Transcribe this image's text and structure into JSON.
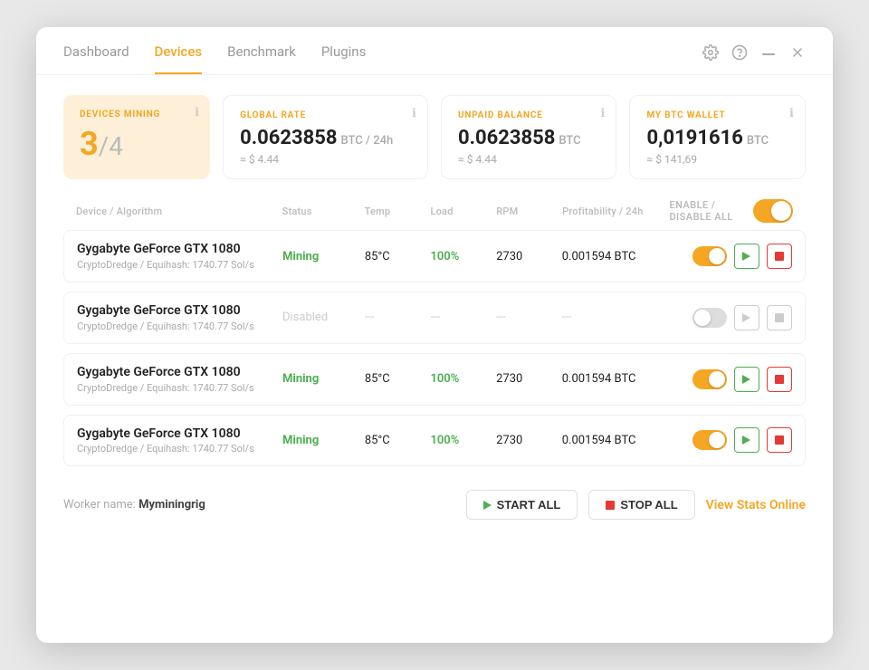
{
  "nav": {
    "tabs": [
      {
        "id": "dashboard",
        "label": "Dashboard",
        "active": false
      },
      {
        "id": "devices",
        "label": "Devices",
        "active": true
      },
      {
        "id": "benchmark",
        "label": "Benchmark",
        "active": false
      },
      {
        "id": "plugins",
        "label": "Plugins",
        "active": false
      }
    ],
    "actions": {
      "settings": "⚙",
      "help": "?",
      "minimize": "—",
      "close": "✕"
    }
  },
  "stats": {
    "devices_mining": {
      "label": "DEVICES MINING",
      "count": "3",
      "total": "/4"
    },
    "global_rate": {
      "label": "GLOBAL RATE",
      "value": "0.0623858",
      "unit": "BTC / 24h",
      "approx": "≈ $ 4.44"
    },
    "unpaid_balance": {
      "label": "UNPAID BALANCE",
      "value": "0.0623858",
      "unit": "BTC",
      "approx": "≈ $ 4.44"
    },
    "btc_wallet": {
      "label": "MY BTC WALLET",
      "value": "0,0191616",
      "unit": "BTC",
      "approx": "≈ $ 141,69"
    }
  },
  "table": {
    "columns": [
      "Device / Algorithm",
      "Status",
      "Temp",
      "Load",
      "RPM",
      "Profitability / 24h",
      "ENABLE / DISABLE ALL"
    ],
    "enable_all_label": "ENABLE / DISABLE ALL",
    "rows": [
      {
        "name": "Gygabyte GeForce GTX 1080",
        "algo": "CryptoDredge / Equihash: 1740.77 Sol/s",
        "status": "Mining",
        "status_type": "mining",
        "temp": "85°C",
        "load": "100%",
        "rpm": "2730",
        "profit": "0.001594 BTC",
        "enabled": true
      },
      {
        "name": "Gygabyte GeForce GTX 1080",
        "algo": "CryptoDredge / Equihash: 1740.77 Sol/s",
        "status": "Disabled",
        "status_type": "disabled",
        "temp": "---",
        "load": "---",
        "rpm": "---",
        "profit": "---",
        "enabled": false
      },
      {
        "name": "Gygabyte GeForce GTX 1080",
        "algo": "CryptoDredge / Equihash: 1740.77 Sol/s",
        "status": "Mining",
        "status_type": "mining",
        "temp": "85°C",
        "load": "100%",
        "rpm": "2730",
        "profit": "0.001594 BTC",
        "enabled": true
      },
      {
        "name": "Gygabyte GeForce GTX 1080",
        "algo": "CryptoDredge / Equihash: 1740.77 Sol/s",
        "status": "Mining",
        "status_type": "mining",
        "temp": "85°C",
        "load": "100%",
        "rpm": "2730",
        "profit": "0.001594 BTC",
        "enabled": true
      }
    ]
  },
  "footer": {
    "worker_prefix": "Worker name:",
    "worker_name": "Myminingrig",
    "start_all": "START ALL",
    "stop_all": "STOP ALL",
    "view_stats": "View Stats Online"
  },
  "colors": {
    "accent": "#f5a623",
    "mining_green": "#4caf50",
    "stop_red": "#e53935",
    "disabled_gray": "#ccc"
  }
}
